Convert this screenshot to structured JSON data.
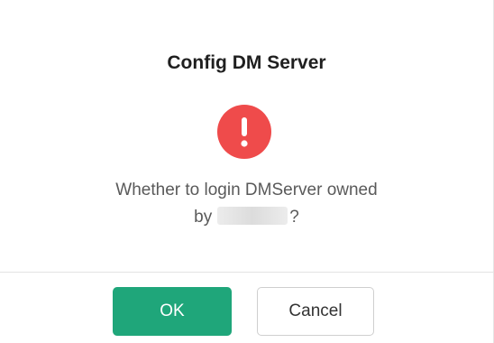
{
  "dialog": {
    "title": "Config DM Server",
    "icon": "exclamation-circle-icon",
    "message_line1": "Whether to login DMServer owned",
    "message_by": "by",
    "message_end": "?",
    "ok_label": "OK",
    "cancel_label": "Cancel"
  },
  "colors": {
    "primary": "#1fa67a",
    "danger": "#ef4b4b"
  }
}
